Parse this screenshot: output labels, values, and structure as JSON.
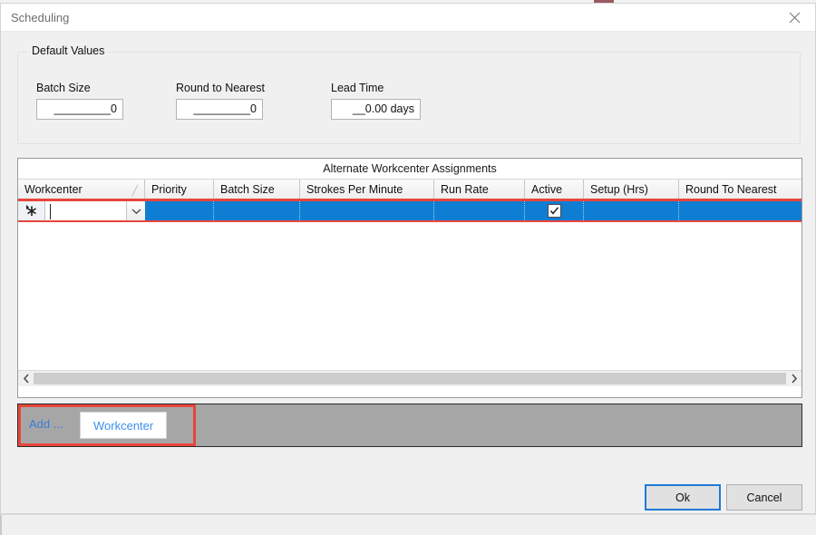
{
  "window": {
    "title": "Scheduling",
    "close_icon": "close-icon"
  },
  "default_values": {
    "legend": "Default Values",
    "fields": [
      {
        "label": "Batch Size",
        "value": "_________0"
      },
      {
        "label": "Round to Nearest",
        "value": "_________0"
      },
      {
        "label": "Lead Time",
        "value": "__0.00 days"
      }
    ]
  },
  "grid": {
    "caption": "Alternate Workcenter Assignments",
    "sort_indicator": "╱",
    "columns": [
      {
        "label": "Workcenter"
      },
      {
        "label": "Priority"
      },
      {
        "label": "Batch Size"
      },
      {
        "label": "Strokes Per Minute"
      },
      {
        "label": "Run Rate"
      },
      {
        "label": "Active"
      },
      {
        "label": "Setup (Hrs)"
      },
      {
        "label": "Round To Nearest"
      }
    ],
    "new_row": {
      "row_indicator_icon": "new-record-asterisk-icon",
      "workcenter_value": "",
      "workcenter_placeholder": "",
      "dropdown_icon": "chevron-down-icon",
      "priority": "",
      "batch_size": "",
      "strokes_per_minute": "",
      "run_rate": "",
      "active_checked": true,
      "setup_hrs": "",
      "round_to_nearest": ""
    },
    "scrollbar": {
      "left_arrow_icon": "chevron-left-icon",
      "right_arrow_icon": "chevron-right-icon"
    }
  },
  "tabstrip": {
    "add_label": "Add ...",
    "tabs": [
      {
        "label": "Workcenter",
        "selected": true
      }
    ]
  },
  "footer": {
    "ok_label": "Ok",
    "cancel_label": "Cancel"
  },
  "colors": {
    "selected_row": "#0f7ed2",
    "highlight_outline": "#e8453c",
    "focus_border": "#1e7ad6",
    "tab_link": "#3b90f0",
    "add_link": "#3b7cd4"
  }
}
